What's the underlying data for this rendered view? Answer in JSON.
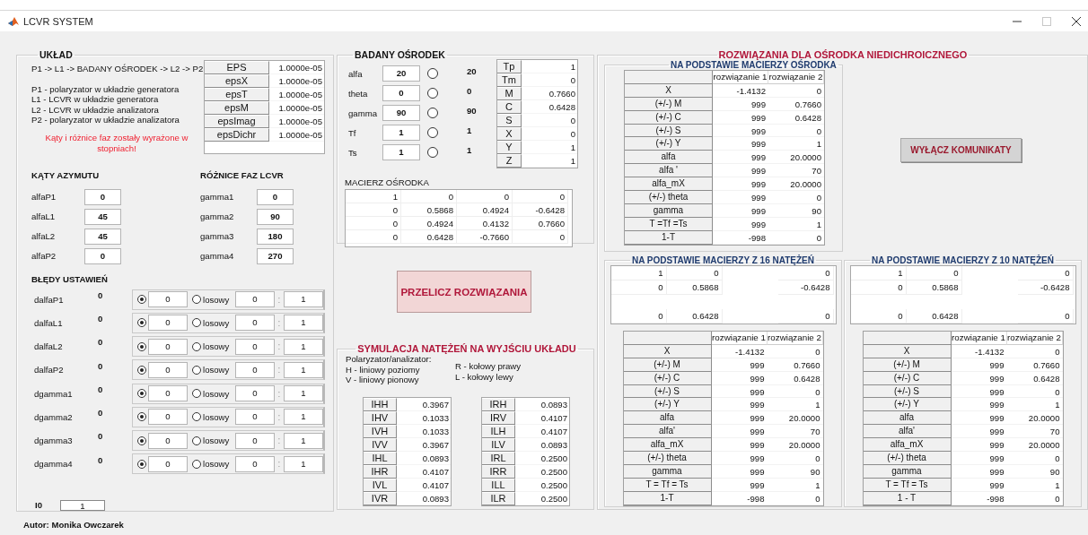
{
  "window": {
    "title": "LCVR SYSTEM"
  },
  "setup": {
    "title": "UKŁAD",
    "chain": "P1 -> L1 -> BADANY OŚRODEK -> L2 -> P2",
    "legend": [
      "P1 - polaryzator w układzie generatora",
      "L1 - LCVR w układzie generatora",
      "L2 - LCVR w układzie analizatora",
      "P2 - polaryzator w układzie analizatora"
    ],
    "note": "Kąty i różnice faz zostały wyrażone w stopniach!",
    "eps_table": [
      {
        "label": "EPS",
        "value": "1.0000e-05"
      },
      {
        "label": "epsX",
        "value": "1.0000e-05"
      },
      {
        "label": "epsT",
        "value": "1.0000e-05"
      },
      {
        "label": "epsM",
        "value": "1.0000e-05"
      },
      {
        "label": "epsImag",
        "value": "1.0000e-05"
      },
      {
        "label": "epsDichr",
        "value": "1.0000e-05"
      }
    ],
    "azimuth": {
      "title": "KĄTY AZYMUTU",
      "fields": [
        {
          "label": "alfaP1",
          "value": "0"
        },
        {
          "label": "alfaL1",
          "value": "45"
        },
        {
          "label": "alfaL2",
          "value": "45"
        },
        {
          "label": "alfaP2",
          "value": "0"
        }
      ]
    },
    "phases": {
      "title": "RÓŻNICE FAZ LCVR",
      "fields": [
        {
          "label": "gamma1",
          "value": "0"
        },
        {
          "label": "gamma2",
          "value": "90"
        },
        {
          "label": "gamma3",
          "value": "180"
        },
        {
          "label": "gamma4",
          "value": "270"
        }
      ]
    },
    "errors": {
      "title": "BŁĘDY USTAWIEŃ",
      "rows": [
        {
          "label": "dalfaP1",
          "reading": "0",
          "fixed_selected": true,
          "random_selected": false,
          "fixed_value": "0",
          "random_label": "losowy",
          "range_from": "0",
          "separator": ":",
          "range_to": "1"
        },
        {
          "label": "dalfaL1",
          "reading": "0",
          "fixed_selected": true,
          "random_selected": false,
          "fixed_value": "0",
          "random_label": "losowy",
          "range_from": "0",
          "separator": ":",
          "range_to": "1"
        },
        {
          "label": "dalfaL2",
          "reading": "0",
          "fixed_selected": true,
          "random_selected": false,
          "fixed_value": "0",
          "random_label": "losowy",
          "range_from": "0",
          "separator": ":",
          "range_to": "1"
        },
        {
          "label": "dalfaP2",
          "reading": "0",
          "fixed_selected": true,
          "random_selected": false,
          "fixed_value": "0",
          "random_label": "losowy",
          "range_from": "0",
          "separator": ":",
          "range_to": "1"
        },
        {
          "label": "dgamma1",
          "reading": "0",
          "fixed_selected": true,
          "random_selected": false,
          "fixed_value": "0",
          "random_label": "losowy",
          "range_from": "0",
          "separator": ":",
          "range_to": "1"
        },
        {
          "label": "dgamma2",
          "reading": "0",
          "fixed_selected": true,
          "random_selected": false,
          "fixed_value": "0",
          "random_label": "losowy",
          "range_from": "0",
          "separator": ":",
          "range_to": "1"
        },
        {
          "label": "dgamma3",
          "reading": "0",
          "fixed_selected": true,
          "random_selected": false,
          "fixed_value": "0",
          "random_label": "losowy",
          "range_from": "0",
          "separator": ":",
          "range_to": "1"
        },
        {
          "label": "dgamma4",
          "reading": "0",
          "fixed_selected": true,
          "random_selected": false,
          "fixed_value": "0",
          "random_label": "losowy",
          "range_from": "0",
          "separator": ":",
          "range_to": "1"
        }
      ]
    },
    "i0": {
      "label": "I0",
      "value": "1"
    }
  },
  "author": "Autor: Monika Owczarek",
  "medium": {
    "title": "BADANY OŚRODEK",
    "params": [
      {
        "label": "alfa",
        "value": "20",
        "selected": false,
        "reading": "20"
      },
      {
        "label": "theta",
        "value": "0",
        "selected": false,
        "reading": "0"
      },
      {
        "label": "gamma",
        "value": "90",
        "selected": false,
        "reading": "90"
      },
      {
        "label": "Tf",
        "value": "1",
        "selected": false,
        "reading": "1"
      },
      {
        "label": "Ts",
        "value": "1",
        "selected": false,
        "reading": "1"
      }
    ],
    "t_table": [
      {
        "label": "Tp",
        "value": "1"
      },
      {
        "label": "Tm",
        "value": "0"
      },
      {
        "label": "M",
        "value": "0.7660"
      },
      {
        "label": "C",
        "value": "0.6428"
      },
      {
        "label": "S",
        "value": "0"
      },
      {
        "label": "X",
        "value": "0"
      },
      {
        "label": "Y",
        "value": "1"
      },
      {
        "label": "Z",
        "value": "1"
      }
    ],
    "matrix": {
      "title": "MACIERZ OŚRODKA",
      "rows": [
        [
          "1",
          "0",
          "0",
          "0"
        ],
        [
          "0",
          "0.5868",
          "0.4924",
          "-0.6428"
        ],
        [
          "0",
          "0.4924",
          "0.4132",
          "0.7660"
        ],
        [
          "0",
          "0.6428",
          "-0.7660",
          "0"
        ]
      ]
    }
  },
  "recalc_button": "PRZELICZ ROZWIĄZANIA",
  "simulation": {
    "title": "SYMULACJA NATĘŻEŃ NA WYJŚCIU UKŁADU",
    "legend_left": [
      "Polaryzator/analizator:",
      "H - liniowy poziomy",
      "V - liniowy pionowy"
    ],
    "legend_right": [
      "R - kołowy prawy",
      "L - kołowy lewy"
    ],
    "table_left": [
      {
        "label": "IHH",
        "value": "0.3967"
      },
      {
        "label": "IHV",
        "value": "0.1033"
      },
      {
        "label": "IVH",
        "value": "0.1033"
      },
      {
        "label": "IVV",
        "value": "0.3967"
      },
      {
        "label": "IHL",
        "value": "0.0893"
      },
      {
        "label": "IHR",
        "value": "0.4107"
      },
      {
        "label": "IVL",
        "value": "0.4107"
      },
      {
        "label": "IVR",
        "value": "0.0893"
      }
    ],
    "table_right": [
      {
        "label": "IRH",
        "value": "0.0893"
      },
      {
        "label": "IRV",
        "value": "0.4107"
      },
      {
        "label": "ILH",
        "value": "0.4107"
      },
      {
        "label": "ILV",
        "value": "0.0893"
      },
      {
        "label": "IRL",
        "value": "0.2500"
      },
      {
        "label": "IRR",
        "value": "0.2500"
      },
      {
        "label": "ILL",
        "value": "0.2500"
      },
      {
        "label": "ILR",
        "value": "0.2500"
      }
    ]
  },
  "solutions": {
    "title": "ROZWIĄZANIA DLA OŚRODKA NIEDICHROICZNEGO",
    "toggle_button": "WYŁĄCZ KOMUNIKATY",
    "panels": [
      {
        "title": "NA PODSTAWIE MACIERZY OŚRODKA",
        "columns": [
          "rozwiązanie 1",
          "rozwiązanie 2"
        ],
        "rows": [
          {
            "label": "X",
            "values": [
              "-1.4132",
              "0"
            ]
          },
          {
            "label": "(+/-) M",
            "values": [
              "999",
              "0.7660"
            ]
          },
          {
            "label": "(+/-) C",
            "values": [
              "999",
              "0.6428"
            ]
          },
          {
            "label": "(+/-) S",
            "values": [
              "999",
              "0"
            ]
          },
          {
            "label": "(+/-) Y",
            "values": [
              "999",
              "1"
            ]
          },
          {
            "label": "alfa",
            "values": [
              "999",
              "20.0000"
            ]
          },
          {
            "label": "alfa '",
            "values": [
              "999",
              "70"
            ]
          },
          {
            "label": "alfa_mX",
            "values": [
              "999",
              "20.0000"
            ]
          },
          {
            "label": "(+/-) theta",
            "values": [
              "999",
              "0"
            ]
          },
          {
            "label": "gamma",
            "values": [
              "999",
              "90"
            ]
          },
          {
            "label": "T =Tf =Ts",
            "values": [
              "999",
              "1"
            ]
          },
          {
            "label": "1-T",
            "values": [
              "-998",
              "0"
            ]
          }
        ]
      },
      {
        "title": "NA PODSTAWIE MACIERZY Z 16 NATĘŻEŃ",
        "matrix": [
          {
            "gap_before": false,
            "column_1": "1",
            "column_2": "0",
            "column_4": "0"
          },
          {
            "gap_before": false,
            "column_1": "0",
            "column_2": "0.5868",
            "column_4": "-0.6428"
          },
          {
            "gap_before": true,
            "column_1": "0",
            "column_2": "0.6428",
            "column_4": "0"
          }
        ],
        "columns": [
          "rozwiązanie 1",
          "rozwiązanie 2"
        ],
        "rows": [
          {
            "label": "X",
            "values": [
              "-1.4132",
              "0"
            ]
          },
          {
            "label": "(+/-) M",
            "values": [
              "999",
              "0.7660"
            ]
          },
          {
            "label": "(+/-) C",
            "values": [
              "999",
              "0.6428"
            ]
          },
          {
            "label": "(+/-) S",
            "values": [
              "999",
              "0"
            ]
          },
          {
            "label": "(+/-) Y",
            "values": [
              "999",
              "1"
            ]
          },
          {
            "label": "alfa",
            "values": [
              "999",
              "20.0000"
            ]
          },
          {
            "label": "alfa'",
            "values": [
              "999",
              "70"
            ]
          },
          {
            "label": "alfa_mX",
            "values": [
              "999",
              "20.0000"
            ]
          },
          {
            "label": "(+/-) theta",
            "values": [
              "999",
              "0"
            ]
          },
          {
            "label": "gamma",
            "values": [
              "999",
              "90"
            ]
          },
          {
            "label": "T = Tf = Ts",
            "values": [
              "999",
              "1"
            ]
          },
          {
            "label": "1-T",
            "values": [
              "-998",
              "0"
            ]
          }
        ]
      },
      {
        "title": "NA PODSTAWIE MACIERZY Z 10 NATĘŻEŃ",
        "matrix": [
          {
            "gap_before": false,
            "column_1": "1",
            "column_2": "0",
            "column_4": "0"
          },
          {
            "gap_before": false,
            "column_1": "0",
            "column_2": "0.5868",
            "column_4": "-0.6428"
          },
          {
            "gap_before": true,
            "column_1": "0",
            "column_2": "0.6428",
            "column_4": "0"
          }
        ],
        "columns": [
          "rozwiązanie 1",
          "rozwiązanie 2"
        ],
        "rows": [
          {
            "label": "X",
            "values": [
              "-1.4132",
              "0"
            ]
          },
          {
            "label": "(+/-) M",
            "values": [
              "999",
              "0.7660"
            ]
          },
          {
            "label": "(+/-) C",
            "values": [
              "999",
              "0.6428"
            ]
          },
          {
            "label": "(+/-) S",
            "values": [
              "999",
              "0"
            ]
          },
          {
            "label": "(+/-) Y",
            "values": [
              "999",
              "1"
            ]
          },
          {
            "label": "alfa",
            "values": [
              "999",
              "20.0000"
            ]
          },
          {
            "label": "alfa'",
            "values": [
              "999",
              "70"
            ]
          },
          {
            "label": "alfa_mX",
            "values": [
              "999",
              "20.0000"
            ]
          },
          {
            "label": "(+/-) theta",
            "values": [
              "999",
              "0"
            ]
          },
          {
            "label": "gamma",
            "values": [
              "999",
              "90"
            ]
          },
          {
            "label": "T = Tf = Ts",
            "values": [
              "999",
              "1"
            ]
          },
          {
            "label": "1 - T",
            "values": [
              "-998",
              "0"
            ]
          }
        ]
      }
    ]
  }
}
